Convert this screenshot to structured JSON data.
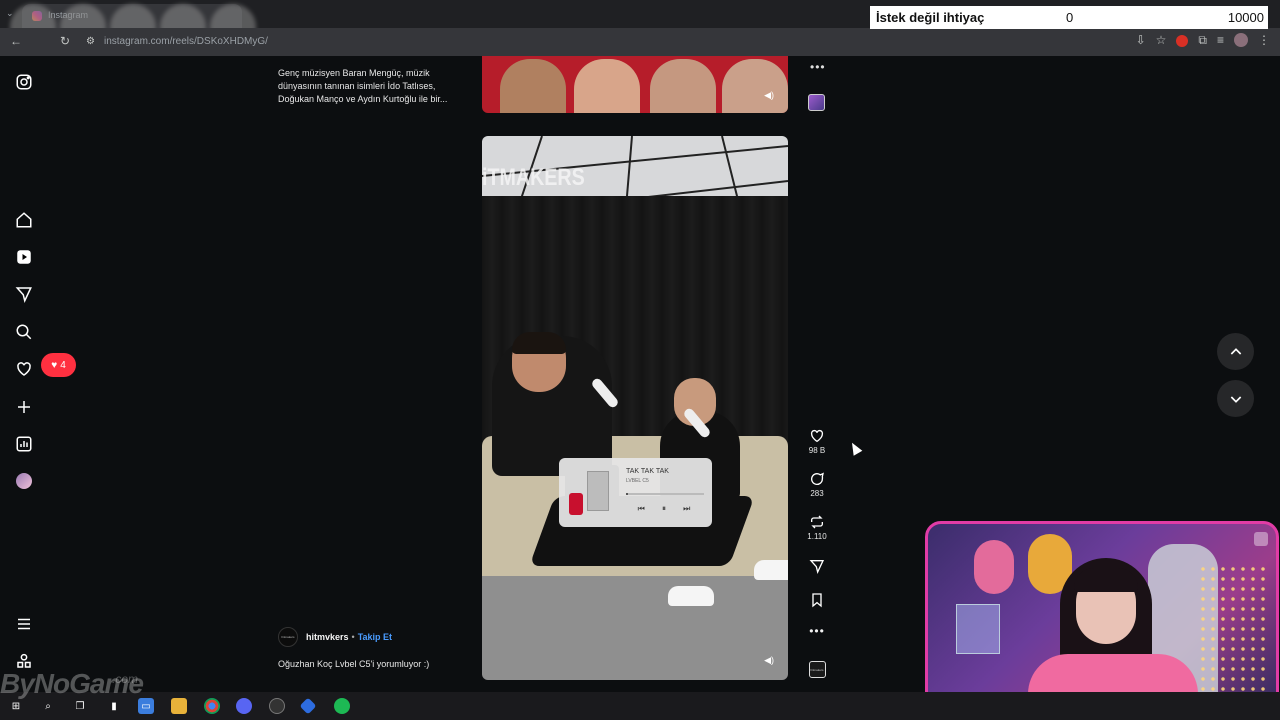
{
  "browser": {
    "tab_title": "Instagram",
    "url": "instagram.com/reels/DSKoXHDMyG/"
  },
  "overlay_counter": {
    "label": "İstek değil ihtiyaç",
    "current": "0",
    "goal": "10000"
  },
  "sidebar": {
    "notification_count": "4"
  },
  "previous_reel": {
    "caption": "Genç müzisyen Baran Mengüç, müzik dünyasının tanınan isimleri İdo Tatlıses, Doğukan Manço ve Aydın Kurtoğlu ile bir..."
  },
  "reel": {
    "brand_text": "iTMAKERS",
    "music_player": {
      "track_title": "TAK TAK TAK",
      "artist": "LVBEL C5",
      "progress": 0.02
    },
    "author": "hitmvkers",
    "separator": "•",
    "follow_label": "Takip Et",
    "avatar_text": "hitmakers",
    "caption": "Oğuzhan Koç Lvbel C5'i yorumluyor :)",
    "likes": "98 B",
    "comments": "283",
    "reposts": "1.110",
    "audio_thumb_text": "hitmakers"
  },
  "watermark": {
    "text": "ByNoGame",
    "suffix": ".com"
  },
  "colors": {
    "accent_red": "#ff3040",
    "follow_blue": "#4a9cff",
    "webcam_border": "#e13ca6"
  }
}
